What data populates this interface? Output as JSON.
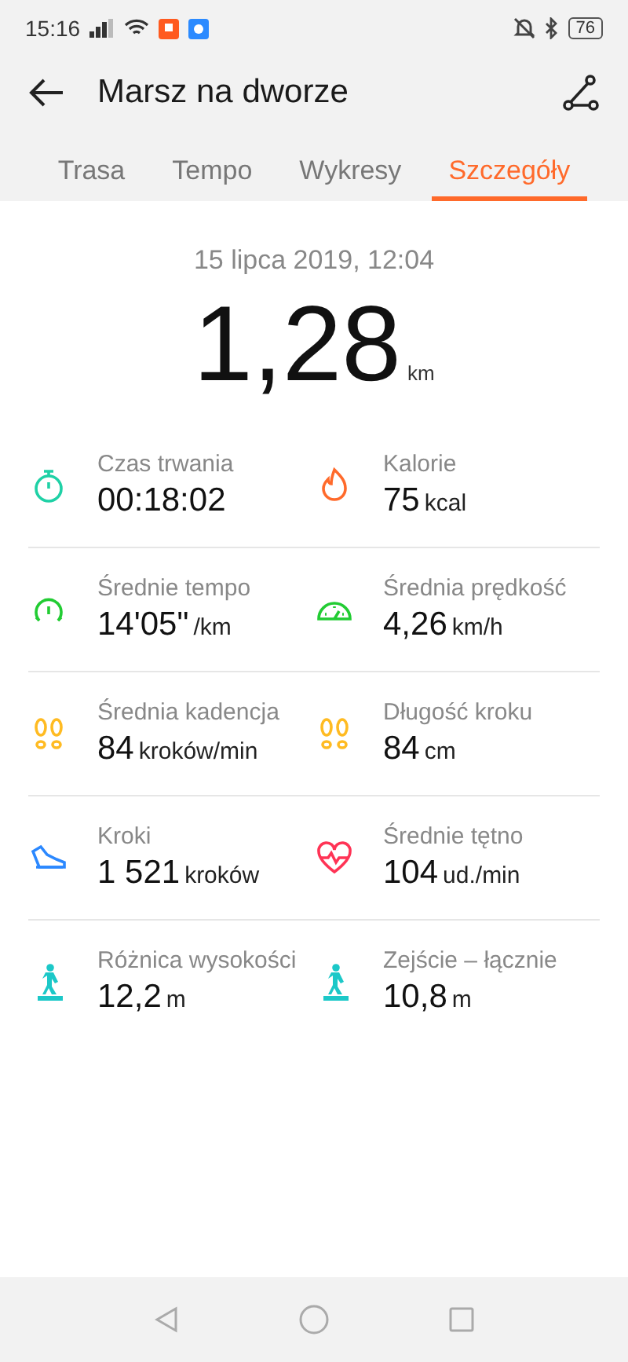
{
  "status_bar": {
    "time": "15:16",
    "battery": "76"
  },
  "header": {
    "title": "Marsz na dworze"
  },
  "tabs": [
    {
      "label": "Trasa",
      "selected": false
    },
    {
      "label": "Tempo",
      "selected": false
    },
    {
      "label": "Wykresy",
      "selected": false
    },
    {
      "label": "Szczegóły",
      "selected": true
    }
  ],
  "summary": {
    "date": "15 lipca 2019, 12:04",
    "distance": "1,28",
    "unit": "km"
  },
  "stats": [
    [
      {
        "kind": "stopwatch",
        "label": "Czas trwania",
        "value": "00:18:02"
      },
      {
        "kind": "flame",
        "label": "Kalorie",
        "value": "75",
        "unit": "kcal"
      }
    ],
    [
      {
        "kind": "pace",
        "label": "Średnie tempo",
        "value": "14'05\"",
        "unit": "/km"
      },
      {
        "kind": "speed",
        "label": "Średnia prędkość",
        "value": "4,26",
        "unit": "km/h"
      }
    ],
    [
      {
        "kind": "footprints",
        "label": "Średnia kadencja",
        "value": "84",
        "unit": "kroków/min"
      },
      {
        "kind": "footprints",
        "label": "Długość kroku",
        "value": "84",
        "unit": "cm"
      }
    ],
    [
      {
        "kind": "shoe",
        "label": "Kroki",
        "value": "1 521",
        "unit": "kroków"
      },
      {
        "kind": "heart",
        "label": "Średnie tętno",
        "value": "104",
        "unit": "ud./min"
      }
    ],
    [
      {
        "kind": "hiker",
        "label": "Różnica wysokości",
        "value": "12,2",
        "unit": "m"
      },
      {
        "kind": "hiker",
        "label": "Zejście – łącznie",
        "value": "10,8",
        "unit": "m"
      }
    ]
  ]
}
